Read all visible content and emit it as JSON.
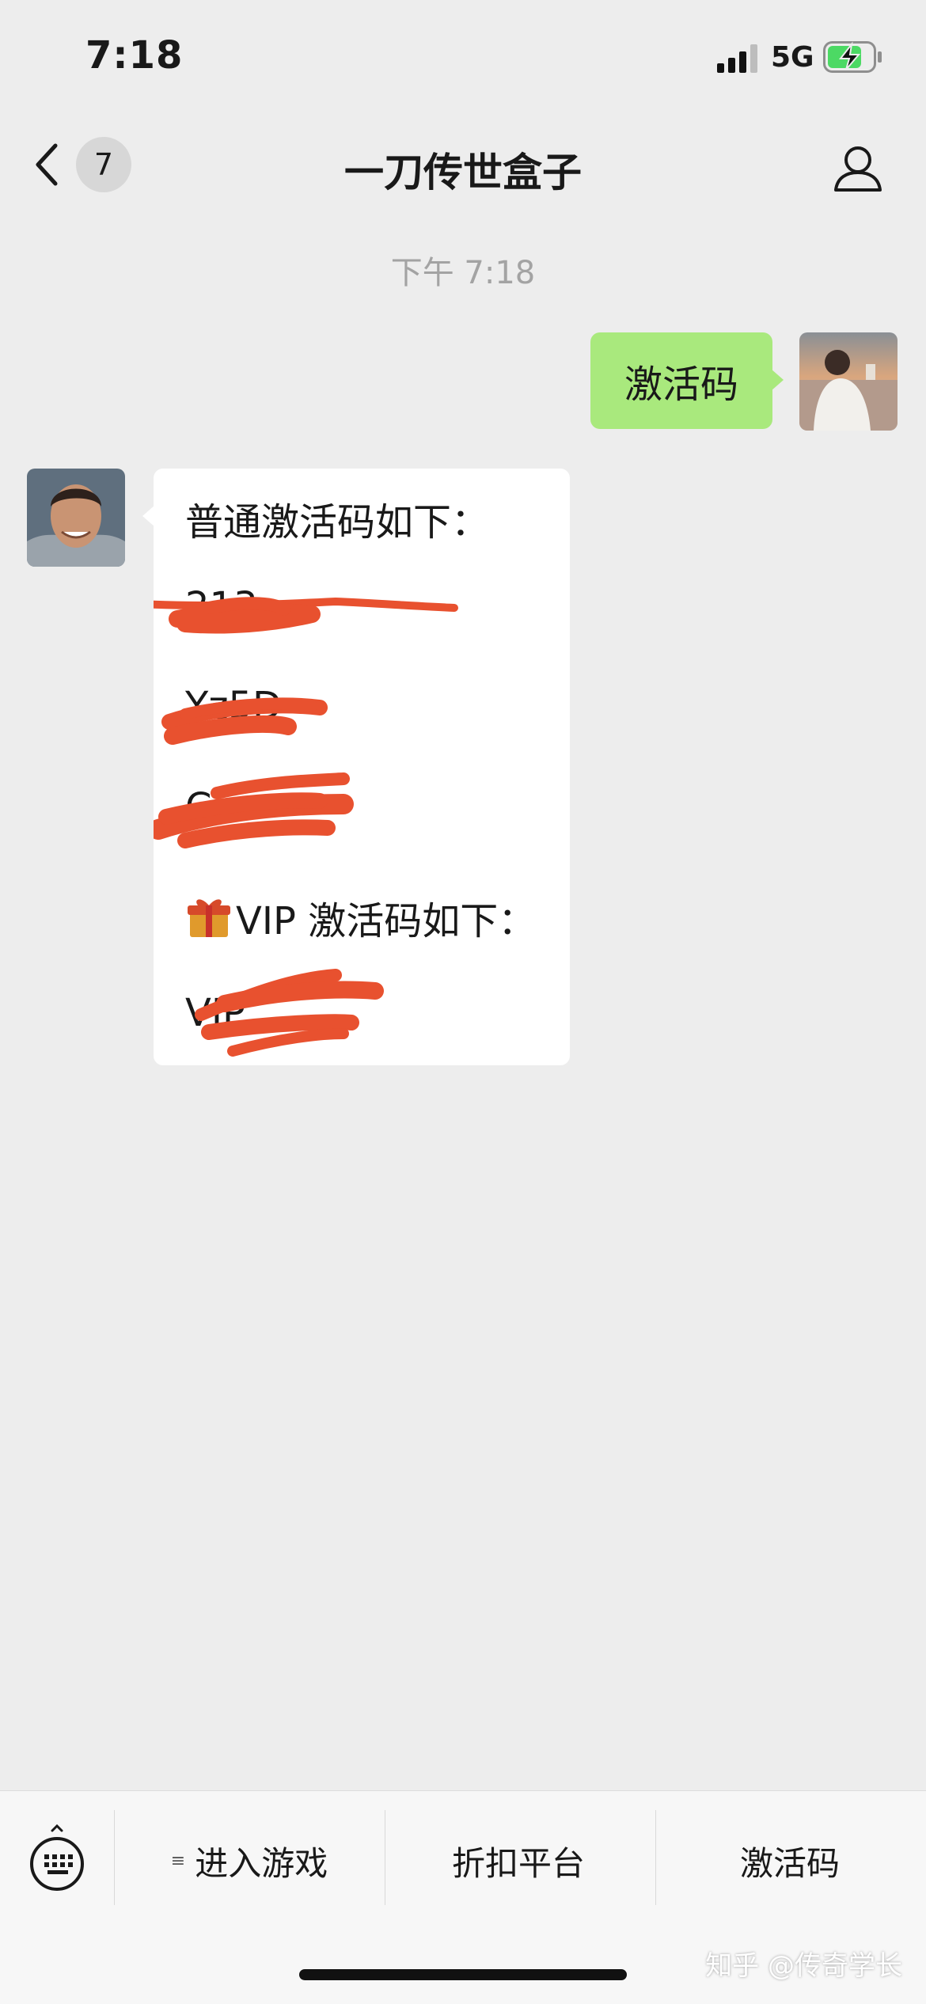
{
  "status_bar": {
    "time": "7:18",
    "network": "5G"
  },
  "nav": {
    "unread_count": "7",
    "title": "一刀传世盒子"
  },
  "chat": {
    "timestamp": "下午 7:18",
    "sent_message": "激活码",
    "reply": {
      "line1": "普通激活码如下：",
      "line2": "213",
      "line3": "Yz5D",
      "line4": "C",
      "line5": "VIP 激活码如下：",
      "line6": "VIP"
    }
  },
  "menu": {
    "items": [
      {
        "label": "进入游戏",
        "has_submenu": true
      },
      {
        "label": "折扣平台"
      },
      {
        "label": "激活码"
      }
    ]
  },
  "watermark": "知乎 @传奇学长",
  "colors": {
    "background": "#ededed",
    "sent_bubble": "#a9e97d",
    "received_bubble": "#ffffff",
    "redaction": "#e8512f",
    "battery_fill": "#4cd964"
  },
  "icons": [
    "signal-icon",
    "battery-charging-icon",
    "back-chevron-icon",
    "person-icon",
    "gift-icon",
    "keyboard-icon"
  ]
}
